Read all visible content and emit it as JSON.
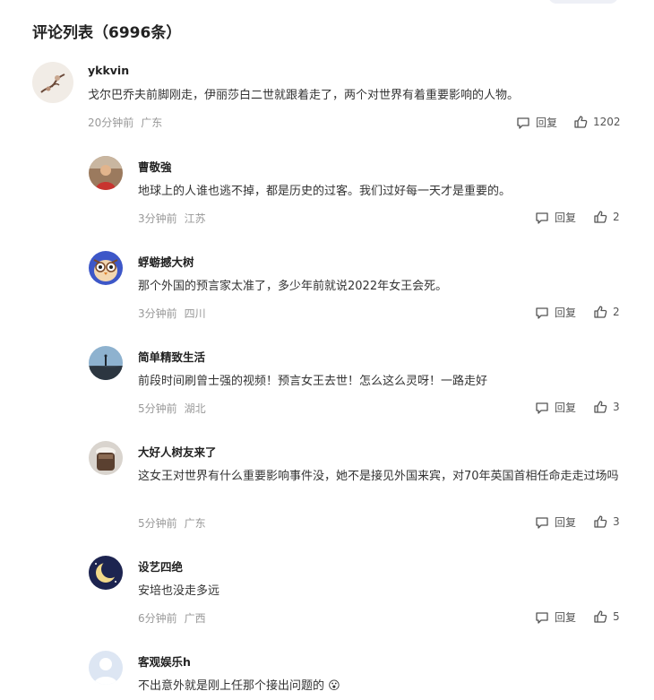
{
  "header": {
    "title": "评论列表（6996条）"
  },
  "actions": {
    "reply_label": "回复"
  },
  "comments": [
    {
      "user": "ykkvin",
      "text": "戈尔巴乔夫前脚刚走，伊丽莎白二世就跟着走了，两个对世界有着重要影响的人物。",
      "time": "20分钟前",
      "location": "广东",
      "likes": "1202"
    },
    {
      "user": "曹敬強",
      "text": "地球上的人谁也逃不掉，都是历史的过客。我们过好每一天才是重要的。",
      "time": "3分钟前",
      "location": "江苏",
      "likes": "2"
    },
    {
      "user": "蜉蝣撼大树",
      "text": "那个外国的预言家太准了，多少年前就说2022年女王会死。",
      "time": "3分钟前",
      "location": "四川",
      "likes": "2"
    },
    {
      "user": "简单精致生活",
      "text": "前段时间刷曾士强的视频！预言女王去世！怎么这么灵呀！一路走好",
      "time": "5分钟前",
      "location": "湖北",
      "likes": "3"
    },
    {
      "user": "大好人树友来了",
      "text": "这女王对世界有什么重要影响事件没，她不是接见外国来宾，对70年英国首相任命走走过场吗",
      "time": "5分钟前",
      "location": "广东",
      "likes": "3"
    },
    {
      "user": "设艺四绝",
      "text": "安培也没走多远",
      "time": "6分钟前",
      "location": "广西",
      "likes": "5"
    },
    {
      "user": "客观娱乐h",
      "text": "不出意外就是刚上任那个接出问题的",
      "emoji": "😮",
      "time": "",
      "location": "",
      "likes": ""
    }
  ]
}
